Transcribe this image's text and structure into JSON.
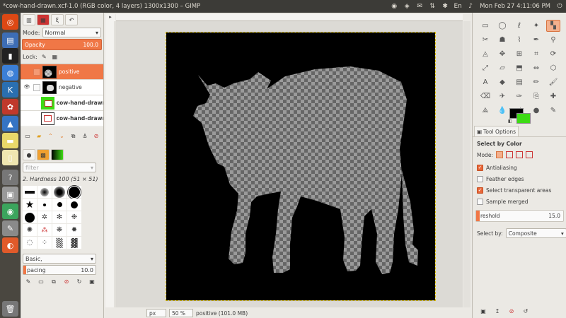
{
  "window_title": "*cow-hand-drawn.xcf-1.0 (RGB color, 4 layers) 1300x1300 – GIMP",
  "tray": {
    "clock": "Mon Feb 27  4:11:06 PM"
  },
  "layers_panel": {
    "mode_label": "Mode:",
    "mode_value": "Normal",
    "opacity_label": "Opacity",
    "opacity_value": "100.0",
    "lock_label": "Lock:",
    "layers": [
      {
        "name": "positive",
        "selected": true
      },
      {
        "name": "negative",
        "selected": false
      },
      {
        "name": "cow-hand-drawn.",
        "selected": false
      },
      {
        "name": "cow-hand-drawn.",
        "selected": false
      }
    ]
  },
  "brushes_panel": {
    "filter_placeholder": "filter",
    "brush_name": "2. Hardness 100 (51 × 51)",
    "preset_value": "Basic,",
    "spacing_label": "pacing",
    "spacing_value": "10.0"
  },
  "statusbar": {
    "unit": "px",
    "zoom": "50 %",
    "info": "positive (101.0 MB)"
  },
  "tool_options": {
    "tab_label": "Tool Options",
    "title": "Select by Color",
    "mode_label": "Mode:",
    "antialiasing": {
      "label": "Antialiasing",
      "checked": true
    },
    "feather": {
      "label": "Feather edges",
      "checked": false
    },
    "transparent": {
      "label": "Select transparent areas",
      "checked": true
    },
    "sample_merged": {
      "label": "Sample merged",
      "checked": false
    },
    "threshold_label": "reshold",
    "threshold_value": "15.0",
    "select_by_label": "Select by:",
    "select_by_value": "Composite"
  },
  "colors": {
    "foreground": "#000000",
    "background": "#3ddb14",
    "accent": "#f07746"
  }
}
